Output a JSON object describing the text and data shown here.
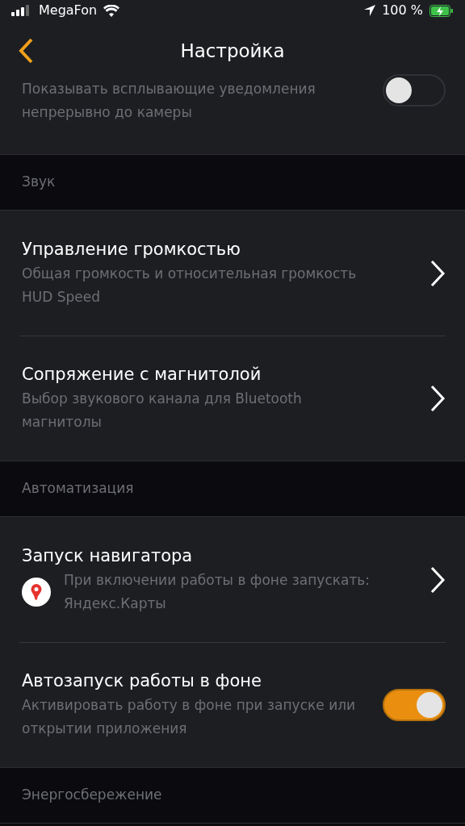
{
  "status_bar": {
    "carrier": "MegaFon",
    "battery": "100 %"
  },
  "nav": {
    "title": "Настройка"
  },
  "sections": [
    {
      "items": [
        {
          "kind": "toggle",
          "subtitle": "Показывать всплывающие уведомления непрерывно до камеры",
          "on": false
        }
      ]
    },
    {
      "header": "Звук",
      "items": [
        {
          "kind": "link",
          "title": "Управление громкостью",
          "subtitle": "Общая громкость и относительная громкость HUD Speed"
        },
        {
          "kind": "link",
          "title": "Сопряжение с магнитолой",
          "subtitle": "Выбор звукового канала для Bluetooth магнитолы"
        }
      ]
    },
    {
      "header": "Автоматизация",
      "items": [
        {
          "kind": "link",
          "title": "Запуск навигатора",
          "subtitle": "При включении работы в фоне запускать: Яндекс.Карты",
          "app_icon": true
        },
        {
          "kind": "toggle",
          "title": "Автозапуск работы в фоне",
          "subtitle": "Активировать работу в фоне при запуске или открытии приложения",
          "on": true
        }
      ]
    },
    {
      "header": "Энергосбережение"
    }
  ]
}
